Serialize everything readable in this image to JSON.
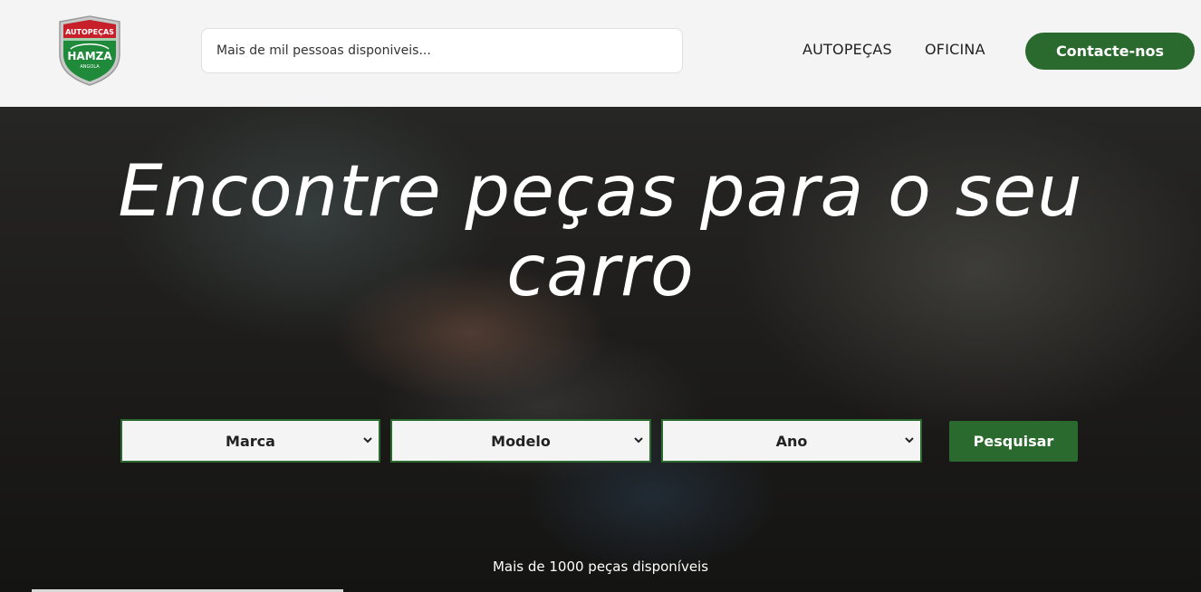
{
  "colors": {
    "brand_green": "#2b6a2e",
    "header_bg": "#f4f4f4",
    "hero_text": "#ffffff"
  },
  "header": {
    "logo": {
      "icon": "autopecas-hamza-badge-icon",
      "top_text": "AUTOPEÇAS",
      "brand_text": "HAMZA",
      "country_text": "ANGOLA"
    },
    "search": {
      "placeholder": "Mais de mil pessoas disponiveis..."
    },
    "nav": {
      "autopecas": "AUTOPEÇAS",
      "oficina": "OFICINA"
    },
    "contact_label": "Contacte-nos"
  },
  "hero": {
    "title": "Encontre peças para o seu carro",
    "filters": {
      "marca": "Marca",
      "modelo": "Modelo",
      "ano": "Ano"
    },
    "search_label": "Pesquisar",
    "subtitle": "Mais de 1000 peças disponíveis"
  }
}
